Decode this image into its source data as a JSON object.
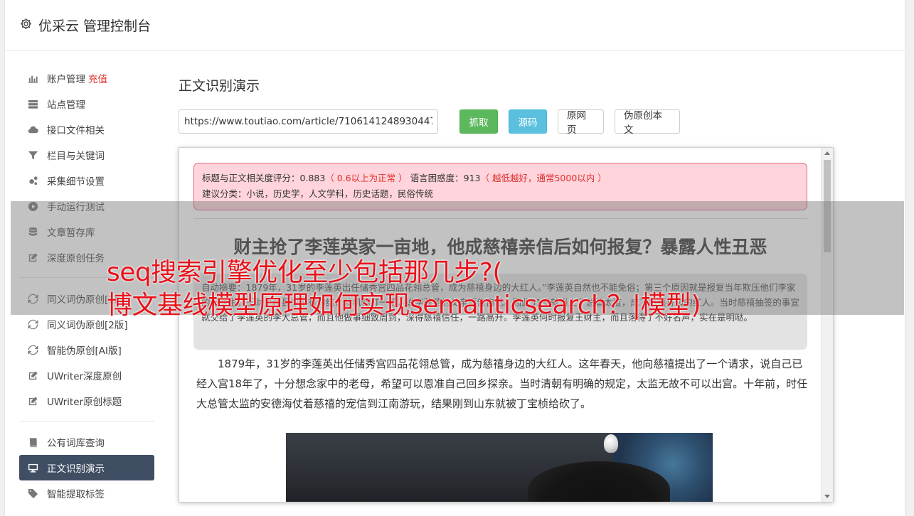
{
  "app": {
    "title": "优采云 管理控制台"
  },
  "sidebar": {
    "group1": [
      {
        "label": "账户管理",
        "badge": "充值",
        "icon": "bar-chart-icon"
      },
      {
        "label": "站点管理",
        "icon": "server-icon"
      },
      {
        "label": "接口文件相关",
        "icon": "cloud-upload-icon"
      },
      {
        "label": "栏目与关键词",
        "icon": "filter-icon"
      },
      {
        "label": "采集细节设置",
        "icon": "gears-icon"
      },
      {
        "label": "手动运行测试",
        "icon": "play-circle-icon"
      },
      {
        "label": "文章暂存库",
        "icon": "database-icon"
      },
      {
        "label": "深度原创任务",
        "icon": "edit-icon"
      }
    ],
    "group2": [
      {
        "label": "同义词伪原创[1版]",
        "icon": "refresh-icon"
      },
      {
        "label": "同义词伪原创[2版]",
        "icon": "refresh-icon"
      },
      {
        "label": "智能伪原创[AI版]",
        "icon": "refresh-icon"
      },
      {
        "label": "UWriter深度原创",
        "icon": "edit-icon"
      },
      {
        "label": "UWriter原创标题",
        "icon": "edit-icon"
      }
    ],
    "group3": [
      {
        "label": "公有词库查询",
        "icon": "book-icon"
      },
      {
        "label": "正文识别演示",
        "icon": "desktop-icon",
        "active": true
      },
      {
        "label": "智能提取标签",
        "icon": "tag-icon"
      }
    ]
  },
  "main": {
    "title": "正文识别演示",
    "url_value": "https://www.toutiao.com/article/7106141248930447",
    "buttons": {
      "fetch": "抓取",
      "source": "源码",
      "original": "原网页",
      "pseudo_original": "伪原创本文"
    }
  },
  "preview": {
    "info": {
      "relevance_label": "标题与正文相关度评分：",
      "relevance_value": "0.883",
      "relevance_note": "（ 0.6以上为正常 ）",
      "perplexity_label": "语言困惑度：",
      "perplexity_value": "913",
      "perplexity_note": "（ 越低越好，通常5000以内 ）",
      "category_label": "建议分类：",
      "category_value": "小说，历史学，人文学科，历史话题，民俗传统"
    },
    "article_title": "财主抢了李莲英家一亩地，他成慈禧亲信后如何报复？暴露人性丑恶",
    "summary": "自动摘要：1879年，31岁的李莲英出任储秀宫四品花翎总管，成为慈禧身边的大红人。”李莲英自然也不能免俗；第三个原因就是报复当年欺压他们李家的王财主。王财主和县令早有勾结，趁机倒打一耙，说李莲英的父亲诬告自己。因此31岁就当上了总管太监，成了慈禧身边的红人。当时慈禧抽签的事宜就交给了李莲英的李大总管，而且他做事细致周到，深得慈禧信任，一路高升。李莲英何时报复王财主，而且落得了不好名声，实在是明哒。",
    "paragraph": "1879年，31岁的李莲英出任储秀宫四品花翎总管，成为慈禧身边的大红人。这年春天，他向慈禧提出了一个请求，说自己已经入宫18年了，十分想念家中的老母，希望可以恩准自己回乡探亲。当时清朝有明确的规定，太监无故不可以出宫。十年前，时任大总管太监的安德海仗着慈禧的宠信到江南游玩，结果刚到山东就被丁宝桢给砍了。"
  },
  "overlay": {
    "line1": "seq搜索引擎优化至少包括那几步?(",
    "line2": "博文基线模型原理如何实现semanticsearch？|模型)"
  },
  "colors": {
    "accent_dark": "#3f4e63",
    "green": "#5cb85c",
    "blue": "#5bc0de",
    "red_text": "#e0312c",
    "overlay_text": "#e8111a"
  }
}
